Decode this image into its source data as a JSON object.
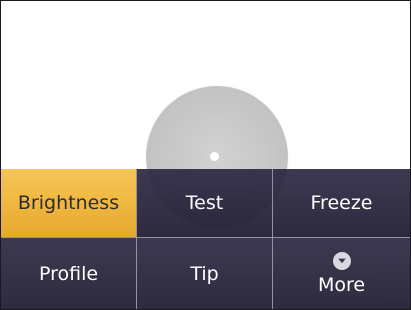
{
  "menu": {
    "row1": [
      {
        "label": "Brightness",
        "selected": true
      },
      {
        "label": "Test",
        "selected": false
      },
      {
        "label": "Freeze",
        "selected": false
      }
    ],
    "row2": [
      {
        "label": "Profile",
        "selected": false
      },
      {
        "label": "Tip",
        "selected": false
      },
      {
        "label": "More",
        "selected": false,
        "icon": "chevron-down-circle-icon"
      }
    ]
  },
  "colors": {
    "selected": "#e5a21e",
    "button": "#2e2a45",
    "divider": "#8d8a9a"
  }
}
